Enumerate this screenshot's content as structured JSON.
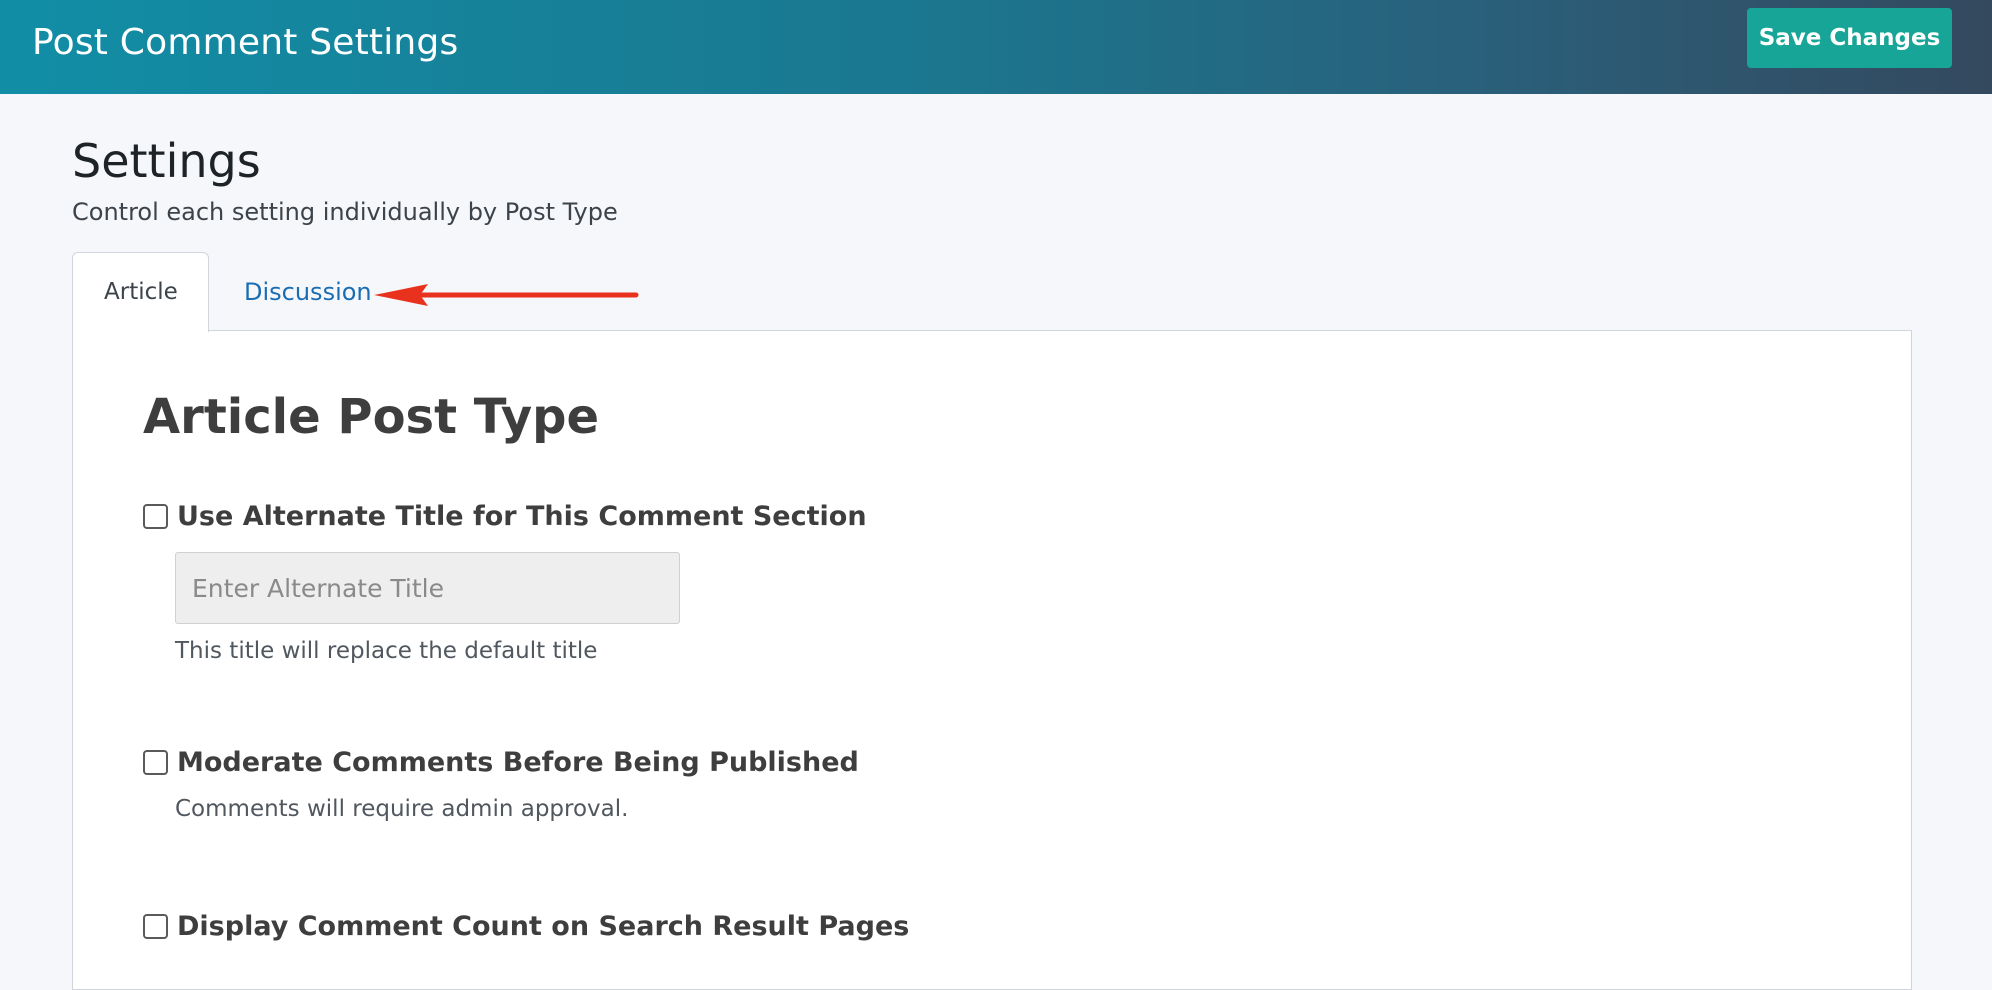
{
  "header": {
    "title": "Post Comment Settings",
    "save_label": "Save Changes",
    "gradient_start": "#118ea6",
    "gradient_end": "#34495e",
    "save_color": "#16a596"
  },
  "settings": {
    "title": "Settings",
    "subtitle": "Control each setting individually by Post Type"
  },
  "tabs": [
    {
      "label": "Article",
      "active": true
    },
    {
      "label": "Discussion",
      "active": false
    }
  ],
  "annotation": {
    "icon": "red-arrow-icon",
    "color": "#e8321e"
  },
  "panel": {
    "title": "Article Post Type",
    "options": [
      {
        "label": "Use Alternate Title for This Comment Section",
        "checked": false,
        "input_placeholder": "Enter Alternate Title",
        "description": "This title will replace the default title"
      },
      {
        "label": "Moderate Comments Before Being Published",
        "checked": false,
        "description": "Comments will require admin approval."
      },
      {
        "label": "Display Comment Count on Search Result Pages",
        "checked": false
      }
    ]
  }
}
